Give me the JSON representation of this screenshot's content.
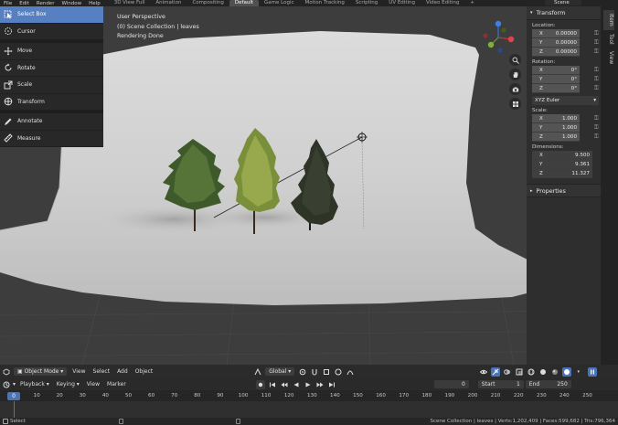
{
  "topbar": {
    "menus": [
      "File",
      "Edit",
      "Render",
      "Window",
      "Help"
    ],
    "workspaces": [
      "3D View Full",
      "Animation",
      "Compositing",
      "Default",
      "Game Logic",
      "Motion Tracking",
      "Scripting",
      "UV Editing",
      "Video Editing"
    ],
    "active_workspace": "Default",
    "add_tab": "+",
    "scene": "Scene"
  },
  "viewport": {
    "info": [
      "User Perspective",
      "(0) Scene Collection | leaves",
      "Rendering Done"
    ]
  },
  "toolbar": {
    "tools": [
      "Select Box",
      "Cursor",
      "Move",
      "Rotate",
      "Scale",
      "Transform",
      "Annotate",
      "Measure"
    ],
    "active_tool": "Select Box"
  },
  "npanel": {
    "title": "Transform",
    "location_label": "Location:",
    "location": [
      {
        "axis": "X",
        "value": "0.00000"
      },
      {
        "axis": "Y",
        "value": "0.00000"
      },
      {
        "axis": "Z",
        "value": "0.00000"
      }
    ],
    "rotation_label": "Rotation:",
    "rotation": [
      {
        "axis": "X",
        "value": "0°"
      },
      {
        "axis": "Y",
        "value": "0°"
      },
      {
        "axis": "Z",
        "value": "0°"
      }
    ],
    "rotation_mode": "XYZ Euler",
    "scale_label": "Scale:",
    "scale": [
      {
        "axis": "X",
        "value": "1.000"
      },
      {
        "axis": "Y",
        "value": "1.000"
      },
      {
        "axis": "Z",
        "value": "1.000"
      }
    ],
    "dimensions_label": "Dimensions:",
    "dimensions": [
      {
        "axis": "X",
        "value": "9.500"
      },
      {
        "axis": "Y",
        "value": "9.361"
      },
      {
        "axis": "Z",
        "value": "11.327"
      }
    ],
    "properties": "Properties",
    "tabs": [
      "Item",
      "Tool",
      "View"
    ],
    "active_tab": "Item"
  },
  "header3d": {
    "mode": "Object Mode",
    "menus": [
      "View",
      "Select",
      "Add",
      "Object"
    ],
    "orientation": "Global"
  },
  "timeline": {
    "menus": [
      "Playback",
      "Keying",
      "View",
      "Marker"
    ],
    "current_frame": "0",
    "start_label": "Start",
    "start": "1",
    "end_label": "End",
    "end": "250",
    "ticks": [
      "0",
      "10",
      "20",
      "30",
      "40",
      "50",
      "60",
      "70",
      "80",
      "90",
      "100",
      "110",
      "120",
      "130",
      "140",
      "150",
      "160",
      "170",
      "180",
      "190",
      "200",
      "210",
      "220",
      "230",
      "240",
      "250"
    ],
    "playhead": "0"
  },
  "status": {
    "left": "Select",
    "stats": "Scene Collection | leaves | Verts:1,202,409 | Faces:599,682 | Tris:796,364"
  }
}
